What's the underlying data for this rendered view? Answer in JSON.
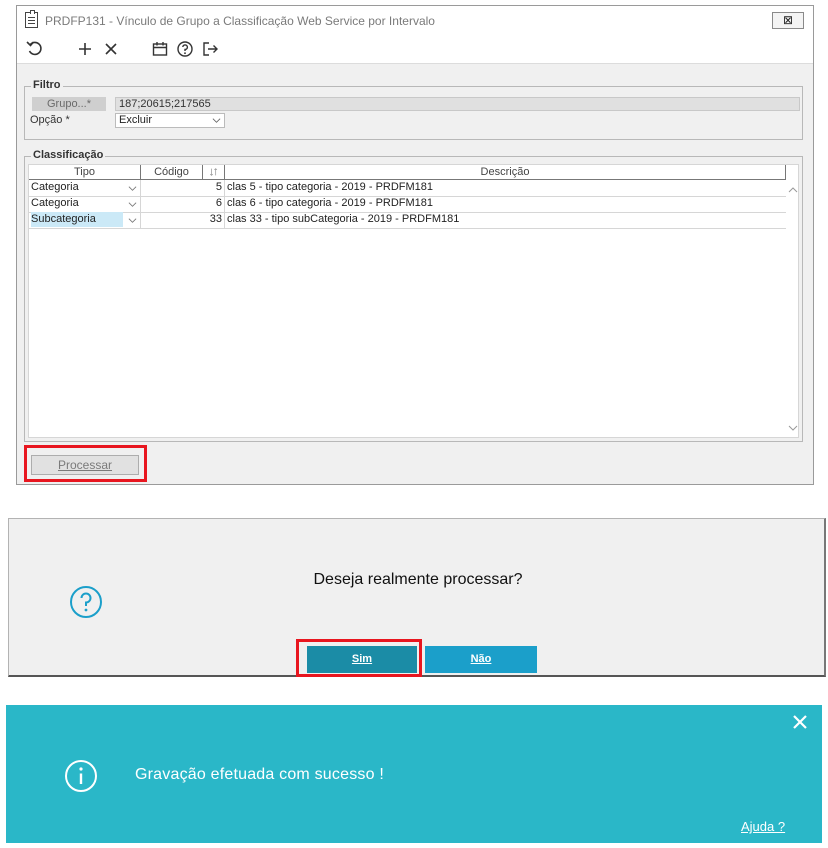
{
  "window": {
    "title": "PRDFP131 - Vínculo de Grupo a Classificação Web Service por Intervalo",
    "close_label": "⊠"
  },
  "toolbar": {
    "icons": [
      "undo-icon",
      "add-icon",
      "delete-icon",
      "calendar-icon",
      "help-icon",
      "exit-icon"
    ]
  },
  "filtro": {
    "legend": "Filtro",
    "grupo_label": "Grupo...*",
    "grupo_value": "187;20615;217565",
    "opcao_label": "Opção *",
    "opcao_value": "Excluir"
  },
  "classificacao": {
    "legend": "Classificação",
    "columns": {
      "tipo": "Tipo",
      "codigo": "Código",
      "descricao": "Descrição"
    },
    "rows": [
      {
        "tipo": "Categoria",
        "codigo": "5",
        "descricao": "clas 5 - tipo categoria - 2019 - PRDFM181"
      },
      {
        "tipo": "Categoria",
        "codigo": "6",
        "descricao": "clas 6 - tipo categoria - 2019 - PRDFM181"
      },
      {
        "tipo": "Subcategoria",
        "codigo": "33",
        "descricao": "clas 33 - tipo subCategoria - 2019 - PRDFM181"
      }
    ]
  },
  "process_button": "Processar",
  "confirm_dialog": {
    "message": "Deseja realmente processar?",
    "yes": "Sim",
    "no": "Não"
  },
  "toast": {
    "message": "Gravação efetuada com sucesso !",
    "help_link": "Ajuda ?"
  },
  "colors": {
    "highlight": "#e8161f",
    "dialog_yes": "#1b8ca6",
    "dialog_no": "#1b9fca",
    "toast_bg": "#2ab7c8",
    "selected_cell": "#cbe9f7"
  }
}
